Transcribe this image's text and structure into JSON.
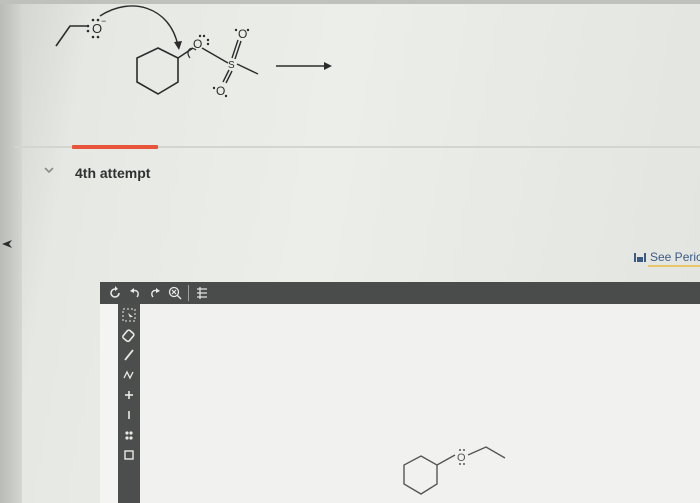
{
  "mechanism": {
    "nucleophile_atom": "O",
    "leaving_group_atoms": [
      "O",
      "S",
      "O",
      "O"
    ]
  },
  "attempt": {
    "label": "4th attempt",
    "collapse_icon": "chevron-down-icon"
  },
  "periodic_link": {
    "label": "See Peric",
    "icon": "periodic-table-icon"
  },
  "editor": {
    "toolbar_icons": [
      "refresh-icon",
      "undo-icon",
      "redo-icon",
      "clear-icon",
      "template-icon"
    ],
    "sidebar_icons": [
      "select-icon",
      "eraser-icon",
      "bond-icon",
      "chain-icon",
      "plus-charge-icon",
      "minus-charge-icon",
      "lone-pair-icon",
      "bracket-icon"
    ],
    "canvas_atom": "O"
  },
  "colors": {
    "accent": "#e8553b",
    "toolbar": "#4a4c4b",
    "link": "#3b5b84"
  }
}
